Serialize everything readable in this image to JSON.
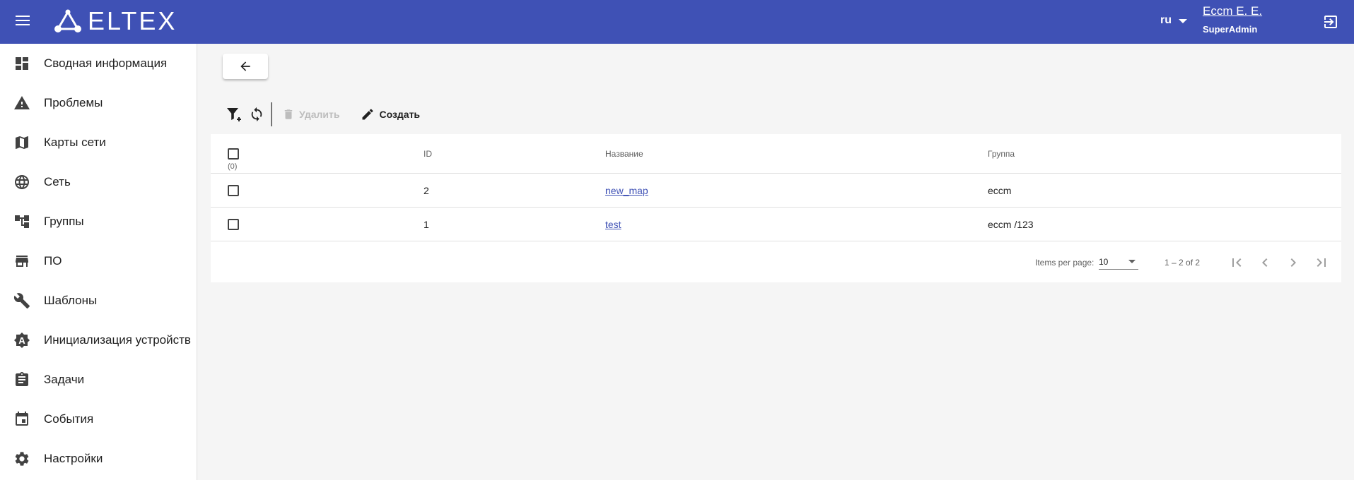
{
  "header": {
    "logo_text": "ELTEX",
    "language": "ru",
    "user_name": "Eccm E. E.",
    "user_role": "SuperAdmin",
    "background_color": "#3f51b5"
  },
  "sidebar": {
    "items": [
      {
        "label": "Сводная информация",
        "icon": "dashboard-icon"
      },
      {
        "label": "Проблемы",
        "icon": "warning-icon"
      },
      {
        "label": "Карты сети",
        "icon": "map-icon"
      },
      {
        "label": "Сеть",
        "icon": "globe-icon"
      },
      {
        "label": "Группы",
        "icon": "account-tree-icon"
      },
      {
        "label": "ПО",
        "icon": "store-icon"
      },
      {
        "label": "Шаблоны",
        "icon": "wrench-icon"
      },
      {
        "label": "Инициализация устройств",
        "icon": "auto-init-icon"
      },
      {
        "label": "Задачи",
        "icon": "clipboard-icon"
      },
      {
        "label": "События",
        "icon": "calendar-icon"
      },
      {
        "label": "Настройки",
        "icon": "gear-icon"
      }
    ]
  },
  "toolbar": {
    "delete_label": "Удалить",
    "create_label": "Создать"
  },
  "table": {
    "selected_count": "(0)",
    "columns": {
      "id": "ID",
      "name": "Название",
      "group": "Группа"
    },
    "rows": [
      {
        "id": "2",
        "name": "new_map",
        "group": "eccm"
      },
      {
        "id": "1",
        "name": "test",
        "group": "eccm /123"
      }
    ]
  },
  "paginator": {
    "items_per_page_label": "Items per page:",
    "page_size": "10",
    "range_label": "1 – 2 of 2"
  },
  "colors": {
    "primary": "#3f51b5",
    "background": "#f5f5f5",
    "disabled": "#bdbdbd"
  }
}
